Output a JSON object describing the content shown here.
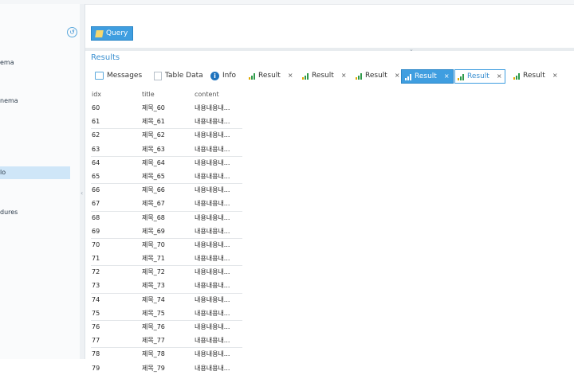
{
  "sidebar": {
    "items": [
      {
        "label": "ema"
      },
      {
        "label": "nema"
      },
      {
        "label": "lo"
      },
      {
        "label": "dures"
      }
    ]
  },
  "query": {
    "button_label": "Query"
  },
  "results": {
    "title": "Results",
    "tabs": [
      {
        "label": "Messages"
      },
      {
        "label": "Table Data"
      },
      {
        "label": "Info"
      },
      {
        "label": "Result"
      },
      {
        "label": "Result"
      },
      {
        "label": "Result"
      },
      {
        "label": "Result"
      },
      {
        "label": "Result"
      },
      {
        "label": "Result"
      }
    ],
    "close_glyph": "×",
    "columns": [
      "idx",
      "title",
      "content"
    ],
    "rows": [
      {
        "idx": "60",
        "title": "제목_60",
        "content": "내용내용내..."
      },
      {
        "idx": "61",
        "title": "제목_61",
        "content": "내용내용내..."
      },
      {
        "idx": "62",
        "title": "제목_62",
        "content": "내용내용내..."
      },
      {
        "idx": "63",
        "title": "제목_63",
        "content": "내용내용내..."
      },
      {
        "idx": "64",
        "title": "제목_64",
        "content": "내용내용내..."
      },
      {
        "idx": "65",
        "title": "제목_65",
        "content": "내용내용내..."
      },
      {
        "idx": "66",
        "title": "제목_66",
        "content": "내용내용내..."
      },
      {
        "idx": "67",
        "title": "제목_67",
        "content": "내용내용내..."
      },
      {
        "idx": "68",
        "title": "제목_68",
        "content": "내용내용내..."
      },
      {
        "idx": "69",
        "title": "제목_69",
        "content": "내용내용내..."
      },
      {
        "idx": "70",
        "title": "제목_70",
        "content": "내용내용내..."
      },
      {
        "idx": "71",
        "title": "제목_71",
        "content": "내용내용내..."
      },
      {
        "idx": "72",
        "title": "제목_72",
        "content": "내용내용내..."
      },
      {
        "idx": "73",
        "title": "제목_73",
        "content": "내용내용내..."
      },
      {
        "idx": "74",
        "title": "제목_74",
        "content": "내용내용내..."
      },
      {
        "idx": "75",
        "title": "제목_75",
        "content": "내용내용내..."
      },
      {
        "idx": "76",
        "title": "제목_76",
        "content": "내용내용내..."
      },
      {
        "idx": "77",
        "title": "제목_77",
        "content": "내용내용내..."
      },
      {
        "idx": "78",
        "title": "제목_78",
        "content": "내용내용내..."
      },
      {
        "idx": "79",
        "title": "제목_79",
        "content": "내용내용내..."
      }
    ]
  },
  "icons": {
    "collapse": "history-icon",
    "query": "pencil-icon",
    "messages": "message-icon",
    "table": "table-icon",
    "info": "info-icon",
    "result": "bar-chart-icon"
  },
  "colors": {
    "accent": "#3f9ee0",
    "selected": "#cfe6f8",
    "title": "#3a8fd0"
  }
}
